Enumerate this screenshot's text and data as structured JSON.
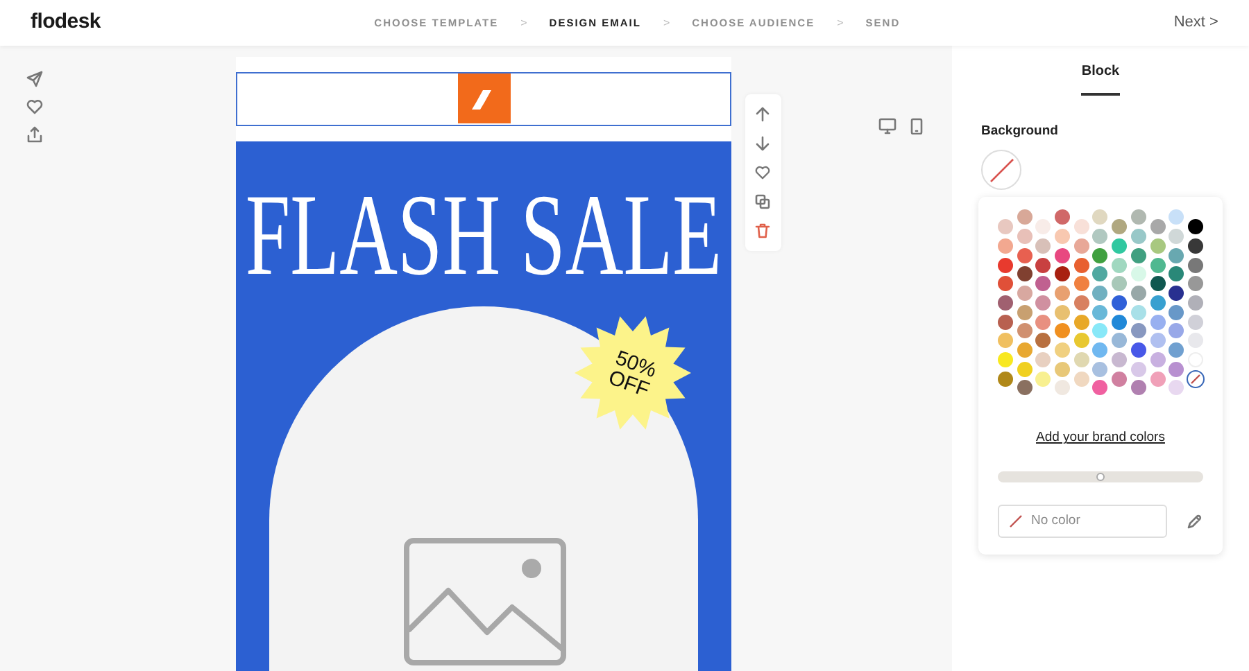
{
  "header": {
    "logo": "flodesk",
    "steps": [
      {
        "label": "CHOOSE TEMPLATE",
        "selected": false
      },
      {
        "label": "DESIGN EMAIL",
        "selected": true
      },
      {
        "label": "CHOOSE AUDIENCE",
        "selected": false
      },
      {
        "label": "SEND",
        "selected": false
      }
    ],
    "separator": ">",
    "next": "Next",
    "next_arrow": ">"
  },
  "email": {
    "title": "FLASH SALE",
    "badge_lines": [
      "50%",
      "OFF"
    ]
  },
  "panel": {
    "tab": "Block",
    "background_label": "Background",
    "brand_link": "Add your brand colors",
    "opacity": {
      "level": 0.5
    },
    "color_field": {
      "placeholder": "No color"
    },
    "swatch_columns": [
      [
        {
          "kind": "color",
          "color": "#e8c8c0",
          "selected": false
        },
        {
          "kind": "color",
          "color": "#f2a890",
          "selected": false
        },
        {
          "kind": "color",
          "color": "#e83a2e",
          "selected": false
        },
        {
          "kind": "color",
          "color": "#e05038",
          "selected": false
        },
        {
          "kind": "color",
          "color": "#a06070",
          "selected": false
        },
        {
          "kind": "color",
          "color": "#b86050",
          "selected": false
        },
        {
          "kind": "color",
          "color": "#f0c060",
          "selected": false
        },
        {
          "kind": "color",
          "color": "#f8e820",
          "selected": false
        },
        {
          "kind": "color",
          "color": "#b08818",
          "selected": false
        }
      ],
      [
        {
          "kind": "color",
          "color": "#d8a898",
          "selected": false
        },
        {
          "kind": "color",
          "color": "#e8c0b8",
          "selected": false
        },
        {
          "kind": "color",
          "color": "#e86050",
          "selected": false
        },
        {
          "kind": "color",
          "color": "#804030",
          "selected": false
        },
        {
          "kind": "color",
          "color": "#d8a8a0",
          "selected": false
        },
        {
          "kind": "color",
          "color": "#c8a070",
          "selected": false
        },
        {
          "kind": "color",
          "color": "#d09070",
          "selected": false
        },
        {
          "kind": "color",
          "color": "#e8a830",
          "selected": false
        },
        {
          "kind": "color",
          "color": "#f0d020",
          "selected": false
        },
        {
          "kind": "color",
          "color": "#8a7060",
          "selected": false
        }
      ],
      [
        {
          "kind": "color",
          "color": "#f8ece8",
          "selected": false
        },
        {
          "kind": "color",
          "color": "#d8c0b8",
          "selected": false
        },
        {
          "kind": "color",
          "color": "#c84040",
          "selected": false
        },
        {
          "kind": "color",
          "color": "#c06090",
          "selected": false
        },
        {
          "kind": "color",
          "color": "#d090a0",
          "selected": false
        },
        {
          "kind": "color",
          "color": "#e89080",
          "selected": false
        },
        {
          "kind": "color",
          "color": "#b87040",
          "selected": false
        },
        {
          "kind": "color",
          "color": "#e8d0c0",
          "selected": false
        },
        {
          "kind": "color",
          "color": "#f8f090",
          "selected": false
        }
      ],
      [
        {
          "kind": "color",
          "color": "#d06868",
          "selected": false
        },
        {
          "kind": "color",
          "color": "#f8c8b0",
          "selected": false
        },
        {
          "kind": "color",
          "color": "#e84880",
          "selected": false
        },
        {
          "kind": "color",
          "color": "#a82010",
          "selected": false
        },
        {
          "kind": "color",
          "color": "#e8a070",
          "selected": false
        },
        {
          "kind": "color",
          "color": "#e8c070",
          "selected": false
        },
        {
          "kind": "color",
          "color": "#f09020",
          "selected": false
        },
        {
          "kind": "color",
          "color": "#f0d080",
          "selected": false
        },
        {
          "kind": "color",
          "color": "#e8c878",
          "selected": false
        },
        {
          "kind": "color",
          "color": "#f0e8e0",
          "selected": false
        }
      ],
      [
        {
          "kind": "color",
          "color": "#f8e0d8",
          "selected": false
        },
        {
          "kind": "color",
          "color": "#e8a898",
          "selected": false
        },
        {
          "kind": "color",
          "color": "#e86030",
          "selected": false
        },
        {
          "kind": "color",
          "color": "#f08040",
          "selected": false
        },
        {
          "kind": "color",
          "color": "#d88060",
          "selected": false
        },
        {
          "kind": "color",
          "color": "#e8a828",
          "selected": false
        },
        {
          "kind": "color",
          "color": "#e8c830",
          "selected": false
        },
        {
          "kind": "color",
          "color": "#e0d8b0",
          "selected": false
        },
        {
          "kind": "color",
          "color": "#f0d8c0",
          "selected": false
        }
      ],
      [
        {
          "kind": "color",
          "color": "#e0d8c0",
          "selected": false
        },
        {
          "kind": "color",
          "color": "#b0c8c0",
          "selected": false
        },
        {
          "kind": "color",
          "color": "#40a040",
          "selected": false
        },
        {
          "kind": "color",
          "color": "#50a8a0",
          "selected": false
        },
        {
          "kind": "color",
          "color": "#70b0c0",
          "selected": false
        },
        {
          "kind": "color",
          "color": "#68b8d8",
          "selected": false
        },
        {
          "kind": "color",
          "color": "#88e8f8",
          "selected": false
        },
        {
          "kind": "color",
          "color": "#70b8f0",
          "selected": false
        },
        {
          "kind": "color",
          "color": "#a8c0e0",
          "selected": false
        },
        {
          "kind": "color",
          "color": "#f060a0",
          "selected": false
        }
      ],
      [
        {
          "kind": "color",
          "color": "#b0a880",
          "selected": false
        },
        {
          "kind": "color",
          "color": "#30c8a0",
          "selected": false
        },
        {
          "kind": "color",
          "color": "#a0d8c0",
          "selected": false
        },
        {
          "kind": "color",
          "color": "#a8c8b8",
          "selected": false
        },
        {
          "kind": "color",
          "color": "#3060d8",
          "selected": false
        },
        {
          "kind": "color",
          "color": "#2088d8",
          "selected": false
        },
        {
          "kind": "color",
          "color": "#98b8d8",
          "selected": false
        },
        {
          "kind": "color",
          "color": "#c8b8d0",
          "selected": false
        },
        {
          "kind": "color",
          "color": "#d080a0",
          "selected": false
        }
      ],
      [
        {
          "kind": "color",
          "color": "#b0b8b0",
          "selected": false
        },
        {
          "kind": "color",
          "color": "#98c8c8",
          "selected": false
        },
        {
          "kind": "color",
          "color": "#40a080",
          "selected": false
        },
        {
          "kind": "color",
          "color": "#d8f8e8",
          "selected": false
        },
        {
          "kind": "color",
          "color": "#98a8a8",
          "selected": false
        },
        {
          "kind": "color",
          "color": "#a8e0e8",
          "selected": false
        },
        {
          "kind": "color",
          "color": "#8898c0",
          "selected": false
        },
        {
          "kind": "color",
          "color": "#4858e8",
          "selected": false
        },
        {
          "kind": "color",
          "color": "#d8c8e8",
          "selected": false
        },
        {
          "kind": "color",
          "color": "#b080b0",
          "selected": false
        }
      ],
      [
        {
          "kind": "color",
          "color": "#a8a8a8",
          "selected": false
        },
        {
          "kind": "color",
          "color": "#a8c880",
          "selected": false
        },
        {
          "kind": "color",
          "color": "#50b890",
          "selected": false
        },
        {
          "kind": "color",
          "color": "#105850",
          "selected": false
        },
        {
          "kind": "color",
          "color": "#38a0d0",
          "selected": false
        },
        {
          "kind": "color",
          "color": "#98b0f0",
          "selected": false
        },
        {
          "kind": "color",
          "color": "#b0c0f0",
          "selected": false
        },
        {
          "kind": "color",
          "color": "#c8b0e0",
          "selected": false
        },
        {
          "kind": "color",
          "color": "#f0a0b8",
          "selected": false
        }
      ],
      [
        {
          "kind": "color",
          "color": "#c8e0f8",
          "selected": false
        },
        {
          "kind": "color",
          "color": "#d0d8d8",
          "selected": false
        },
        {
          "kind": "color",
          "color": "#68a8b0",
          "selected": false
        },
        {
          "kind": "color",
          "color": "#2a8878",
          "selected": false
        },
        {
          "kind": "color",
          "color": "#283090",
          "selected": false
        },
        {
          "kind": "color",
          "color": "#6898c8",
          "selected": false
        },
        {
          "kind": "color",
          "color": "#98a8e8",
          "selected": false
        },
        {
          "kind": "color",
          "color": "#70a0d0",
          "selected": false
        },
        {
          "kind": "color",
          "color": "#b890d0",
          "selected": false
        },
        {
          "kind": "color",
          "color": "#e8d8f0",
          "selected": false
        }
      ],
      [
        {
          "kind": "color",
          "color": "#000000",
          "selected": false
        },
        {
          "kind": "color",
          "color": "#383838",
          "selected": false
        },
        {
          "kind": "color",
          "color": "#787878",
          "selected": false
        },
        {
          "kind": "color",
          "color": "#989898",
          "selected": false
        },
        {
          "kind": "color",
          "color": "#b0b0b8",
          "selected": false
        },
        {
          "kind": "color",
          "color": "#d0d0d8",
          "selected": false
        },
        {
          "kind": "color",
          "color": "#e8e8ec",
          "selected": false
        },
        {
          "kind": "color",
          "color": "#ffffff",
          "selected": false
        },
        {
          "kind": "none",
          "selected": true
        }
      ]
    ]
  }
}
